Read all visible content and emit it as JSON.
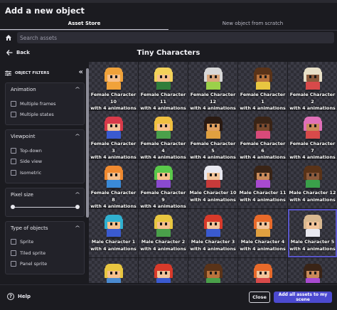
{
  "window": {
    "title": "Add a new object"
  },
  "tabs": [
    {
      "label": "Asset Store",
      "active": true
    },
    {
      "label": "New object from scratch",
      "active": false
    }
  ],
  "search": {
    "placeholder": "Search assets",
    "value": ""
  },
  "nav": {
    "back_label": "Back",
    "page_title": "Tiny Characters"
  },
  "filters": {
    "title": "OBJECT FILTERS",
    "sections": {
      "animation": {
        "title": "Animation",
        "options": [
          "Multiple frames",
          "Multiple states"
        ]
      },
      "viewpoint": {
        "title": "Viewpoint",
        "options": [
          "Top-down",
          "Side view",
          "Isometric"
        ]
      },
      "pixel_size": {
        "title": "Pixel size",
        "range_min_fraction": 0,
        "range_max_fraction": 1
      },
      "type_of_objects": {
        "title": "Type of objects",
        "options": [
          "Sprite",
          "Tiled sprite",
          "Panel sprite"
        ]
      }
    }
  },
  "assets": [
    {
      "name": "Female Character 10",
      "sub": "with 4 animations",
      "hair": "#f0a23a",
      "skin": "#f6c08c",
      "shirt": "#f0a23a",
      "sel": false
    },
    {
      "name": "Female Character 11",
      "sub": "with 4 animations",
      "hair": "#f3d25a",
      "skin": "#f6c08c",
      "shirt": "#2f7d3a",
      "sel": false
    },
    {
      "name": "Female Character 12",
      "sub": "with 4 animations",
      "hair": "#d8d8d8",
      "skin": "#d9a57a",
      "shirt": "#9bd04a",
      "sel": false
    },
    {
      "name": "Female Character 1",
      "sub": "with 4 animations",
      "hair": "#5a3318",
      "skin": "#b8733d",
      "shirt": "#e8c640",
      "sel": false
    },
    {
      "name": "Female Character 2",
      "sub": "with 4 animations",
      "hair": "#e8e0c8",
      "skin": "#8b5a3c",
      "shirt": "#d84a4a",
      "sel": false
    },
    {
      "name": "Female Character 3",
      "sub": "with 4 animations",
      "hair": "#d83a4a",
      "skin": "#f2c49a",
      "shirt": "#3a5ad0",
      "sel": false
    },
    {
      "name": "Female Character 4",
      "sub": "with 4 animations",
      "hair": "#f0c040",
      "skin": "#f6c08c",
      "shirt": "#4aa04a",
      "sel": false
    },
    {
      "name": "Female Character 5",
      "sub": "with 4 animations",
      "hair": "#2a1a12",
      "skin": "#e0a060",
      "shirt": "#e0a040",
      "sel": false
    },
    {
      "name": "Female Character 6",
      "sub": "with 4 animations",
      "hair": "#3a2416",
      "skin": "#7a4a2e",
      "shirt": "#d84a7a",
      "sel": false
    },
    {
      "name": "Female Character 7",
      "sub": "with 4 animations",
      "hair": "#e070b8",
      "skin": "#c98a5a",
      "shirt": "#d84a4a",
      "sel": false
    },
    {
      "name": "Female Character 8",
      "sub": "with 4 animations",
      "hair": "#f08a30",
      "skin": "#f6c08c",
      "shirt": "#3a8ad8",
      "sel": false
    },
    {
      "name": "Female Character 9",
      "sub": "with 4 animations",
      "hair": "#5ac84a",
      "skin": "#f6c08c",
      "shirt": "#8a4ad0",
      "sel": false
    },
    {
      "name": "Male Character 10",
      "sub": "with 4 animations",
      "hair": "#e8e8f0",
      "skin": "#f2c49a",
      "shirt": "#c83a3a",
      "sel": false
    },
    {
      "name": "Male Character 11",
      "sub": "with 4 animations",
      "hair": "#3a2416",
      "skin": "#c98a5a",
      "shirt": "#a84ad0",
      "sel": false
    },
    {
      "name": "Male Character 12",
      "sub": "with 4 animations",
      "hair": "#5a3318",
      "skin": "#8b5a3c",
      "shirt": "#3aa04a",
      "sel": false
    },
    {
      "name": "Male Character 1",
      "sub": "with 4 animations",
      "hair": "#30b0d0",
      "skin": "#f6c08c",
      "shirt": "#3a5ad0",
      "sel": false
    },
    {
      "name": "Male Character 2",
      "sub": "with 4 animations",
      "hair": "#e8c640",
      "skin": "#f6c08c",
      "shirt": "#4aa04a",
      "sel": false
    },
    {
      "name": "Male Character 3",
      "sub": "with 4 animations",
      "hair": "#d83a2a",
      "skin": "#f2c49a",
      "shirt": "#3a5ad0",
      "sel": false
    },
    {
      "name": "Male Character 4",
      "sub": "with 4 animations",
      "hair": "#e86a2a",
      "skin": "#f2c49a",
      "shirt": "#e0a040",
      "sel": false
    },
    {
      "name": "Male Character 5",
      "sub": "with 4 animations",
      "hair": "#d8b890",
      "skin": "#f2c49a",
      "shirt": "#e8e8f0",
      "sel": true
    },
    {
      "name": "",
      "sub": "",
      "hair": "#e8c640",
      "skin": "#f6c08c",
      "shirt": "#4a8ad0",
      "sel": false
    },
    {
      "name": "",
      "sub": "",
      "hair": "#d83a2a",
      "skin": "#f2c49a",
      "shirt": "#3a5ad0",
      "sel": false
    },
    {
      "name": "",
      "sub": "",
      "hair": "#5a3318",
      "skin": "#b8733d",
      "shirt": "#4aa04a",
      "sel": false
    },
    {
      "name": "",
      "sub": "",
      "hair": "#e86a2a",
      "skin": "#f2c49a",
      "shirt": "#d84a4a",
      "sel": false
    },
    {
      "name": "",
      "sub": "",
      "hair": "#3a2416",
      "skin": "#c98a5a",
      "shirt": "#a84ad0",
      "sel": false
    }
  ],
  "footer": {
    "help_label": "Help",
    "close_label": "Close",
    "add_all_label": "Add all assets to my scene"
  },
  "colors": {
    "accent": "#4c4ad0",
    "background": "#1b1b20"
  }
}
